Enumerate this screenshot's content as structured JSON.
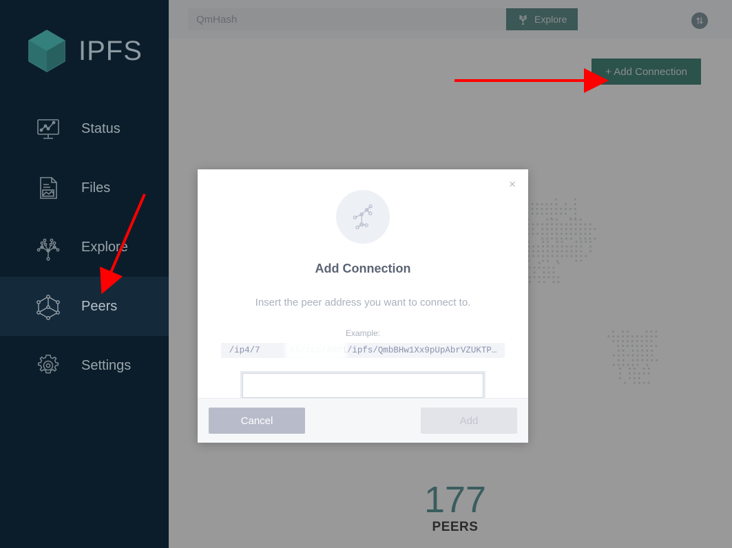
{
  "app": {
    "brand": "IPFS"
  },
  "sidebar": {
    "items": [
      {
        "label": "Status",
        "icon": "status-chart-icon",
        "active": false
      },
      {
        "label": "Files",
        "icon": "file-document-icon",
        "active": false
      },
      {
        "label": "Explore",
        "icon": "merkle-tree-icon",
        "active": false
      },
      {
        "label": "Peers",
        "icon": "cube-nodes-icon",
        "active": true
      },
      {
        "label": "Settings",
        "icon": "gear-icon",
        "active": false
      }
    ]
  },
  "header": {
    "search_placeholder": "QmHash",
    "search_value": "",
    "explore_label": "Explore",
    "explore_icon": "merkle-tree-icon",
    "bandwidth_icon": "up-down-arrows-icon"
  },
  "toolbar": {
    "add_connection_label": "+ Add Connection"
  },
  "peers_panel": {
    "count": "177",
    "count_label": "PEERS",
    "count_color": "#2e7a7f"
  },
  "modal": {
    "close_label": "×",
    "icon": "peer-network-graph-icon",
    "title": "Add Connection",
    "description": "Insert the peer address you want to connect to.",
    "example_label": "Example:",
    "example_value": "/ip4/7    65/tcp/4001/ipfs/QmbBHw1Xx9pUpAbrVZUKTP…",
    "input_value": "",
    "input_placeholder": "",
    "cancel_label": "Cancel",
    "add_label": "Add",
    "add_disabled": true
  },
  "annotations": {
    "arrow_color": "#fe0000",
    "arrow_to_add_connection": "arrow pointing right to Add Connection button",
    "arrow_to_peers": "arrow pointing down-left to Peers sidebar item"
  },
  "colors": {
    "sidebar_bg": "#0b1d2a",
    "sidebar_active_bg": "#14293a",
    "accent_green": "#0e6354",
    "explore_green": "#2f6e6b",
    "teal": "#2e7a7f"
  }
}
